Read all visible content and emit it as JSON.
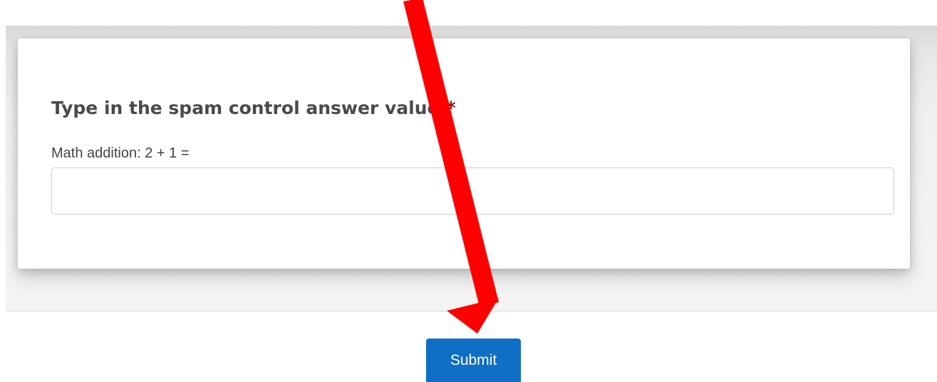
{
  "form": {
    "question": "Type in the spam control answer value:",
    "required_marker": "*",
    "hint": "Math addition: 2 + 1 =",
    "answer_value": "",
    "answer_placeholder": ""
  },
  "submit": {
    "label": "Submit"
  },
  "annotation": {
    "arrow_color": "#ff0000"
  },
  "colors": {
    "button": "#0f6fc6",
    "required": "#8b1a1a"
  }
}
